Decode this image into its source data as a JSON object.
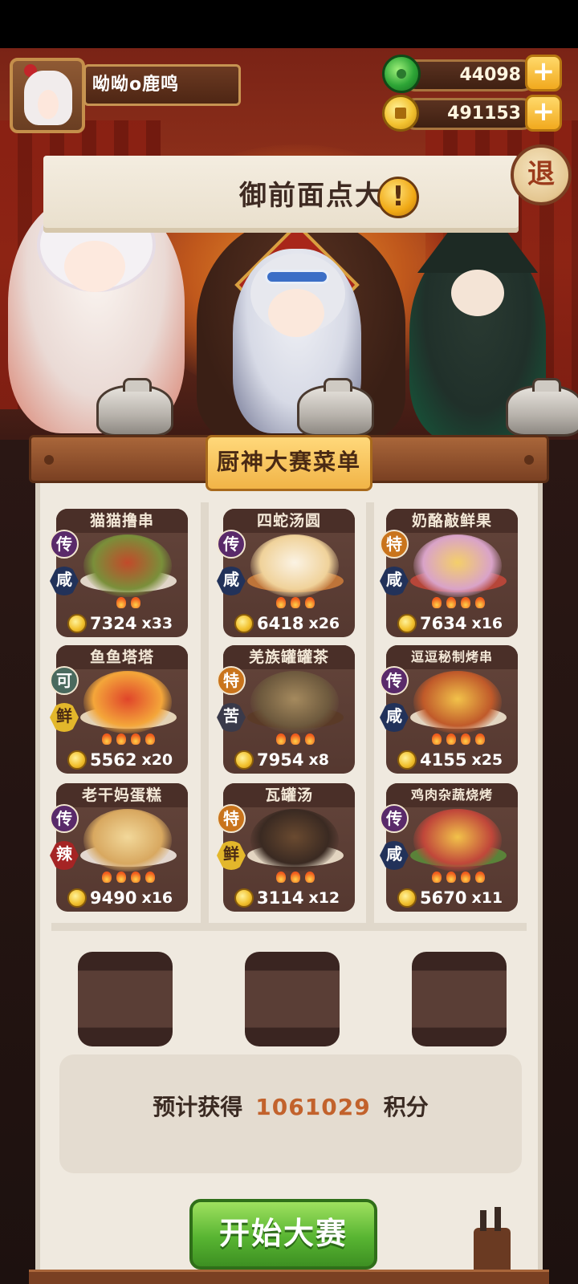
{
  "player": {
    "name": "呦呦o鹿鸣"
  },
  "currency": {
    "jade": "44098",
    "coins": "491153",
    "plus_label": "+"
  },
  "banner": {
    "title": "御前面点大赛",
    "alert_label": "!"
  },
  "exit_label": "退",
  "menu": {
    "title": "厨神大赛菜单",
    "dishes": [
      {
        "name": "猫猫撸串",
        "rarity": "传",
        "flavor": "咸",
        "flames": 2,
        "price": "7324",
        "qty": "x33",
        "colors": [
          "#c24a2a",
          "#7a8f3a",
          "#efe6d8"
        ]
      },
      {
        "name": "四蛇汤圆",
        "rarity": "传",
        "flavor": "咸",
        "flames": 3,
        "price": "6418",
        "qty": "x26",
        "colors": [
          "#fbf3e4",
          "#f0d29a",
          "#c97a3a"
        ]
      },
      {
        "name": "奶酪敲鲜果",
        "rarity": "特",
        "flavor": "咸",
        "flames": 4,
        "price": "7634",
        "qty": "x16",
        "colors": [
          "#f4cf6a",
          "#d9a3c8",
          "#c0473a"
        ]
      },
      {
        "name": "鱼鱼塔塔",
        "rarity": "可",
        "flavor": "鲜",
        "flames": 4,
        "price": "5562",
        "qty": "x20",
        "colors": [
          "#e0452a",
          "#f4a63a",
          "#f2e2c4"
        ]
      },
      {
        "name": "羌族罐罐茶",
        "rarity": "特",
        "flavor": "苦",
        "flames": 3,
        "price": "7954",
        "qty": "x8",
        "colors": [
          "#a58a5e",
          "#6e5a3e",
          "#5a3a26"
        ]
      },
      {
        "name": "逗逗秘制烤串",
        "rarity": "传",
        "flavor": "咸",
        "flames": 4,
        "price": "4155",
        "qty": "x25",
        "colors": [
          "#f2c24a",
          "#c05a2a",
          "#f2e6d0"
        ]
      },
      {
        "name": "老干妈蛋糕",
        "rarity": "传",
        "flavor": "辣",
        "flames": 4,
        "price": "9490",
        "qty": "x16",
        "colors": [
          "#f2d89a",
          "#d8a860",
          "#f2e8e0"
        ]
      },
      {
        "name": "瓦罐汤",
        "rarity": "特",
        "flavor": "鲜",
        "flames": 3,
        "price": "3114",
        "qty": "x12",
        "colors": [
          "#6a4a30",
          "#3a2a22",
          "#f2e6d0"
        ]
      },
      {
        "name": "鸡肉杂蔬烧烤",
        "rarity": "传",
        "flavor": "咸",
        "flames": 4,
        "price": "5670",
        "qty": "x11",
        "colors": [
          "#f2c24a",
          "#c0473a",
          "#5a8a3a"
        ]
      }
    ]
  },
  "estimate": {
    "prefix": "预计获得",
    "value": "1061029",
    "suffix": "积分"
  },
  "start_button": "开始大赛"
}
